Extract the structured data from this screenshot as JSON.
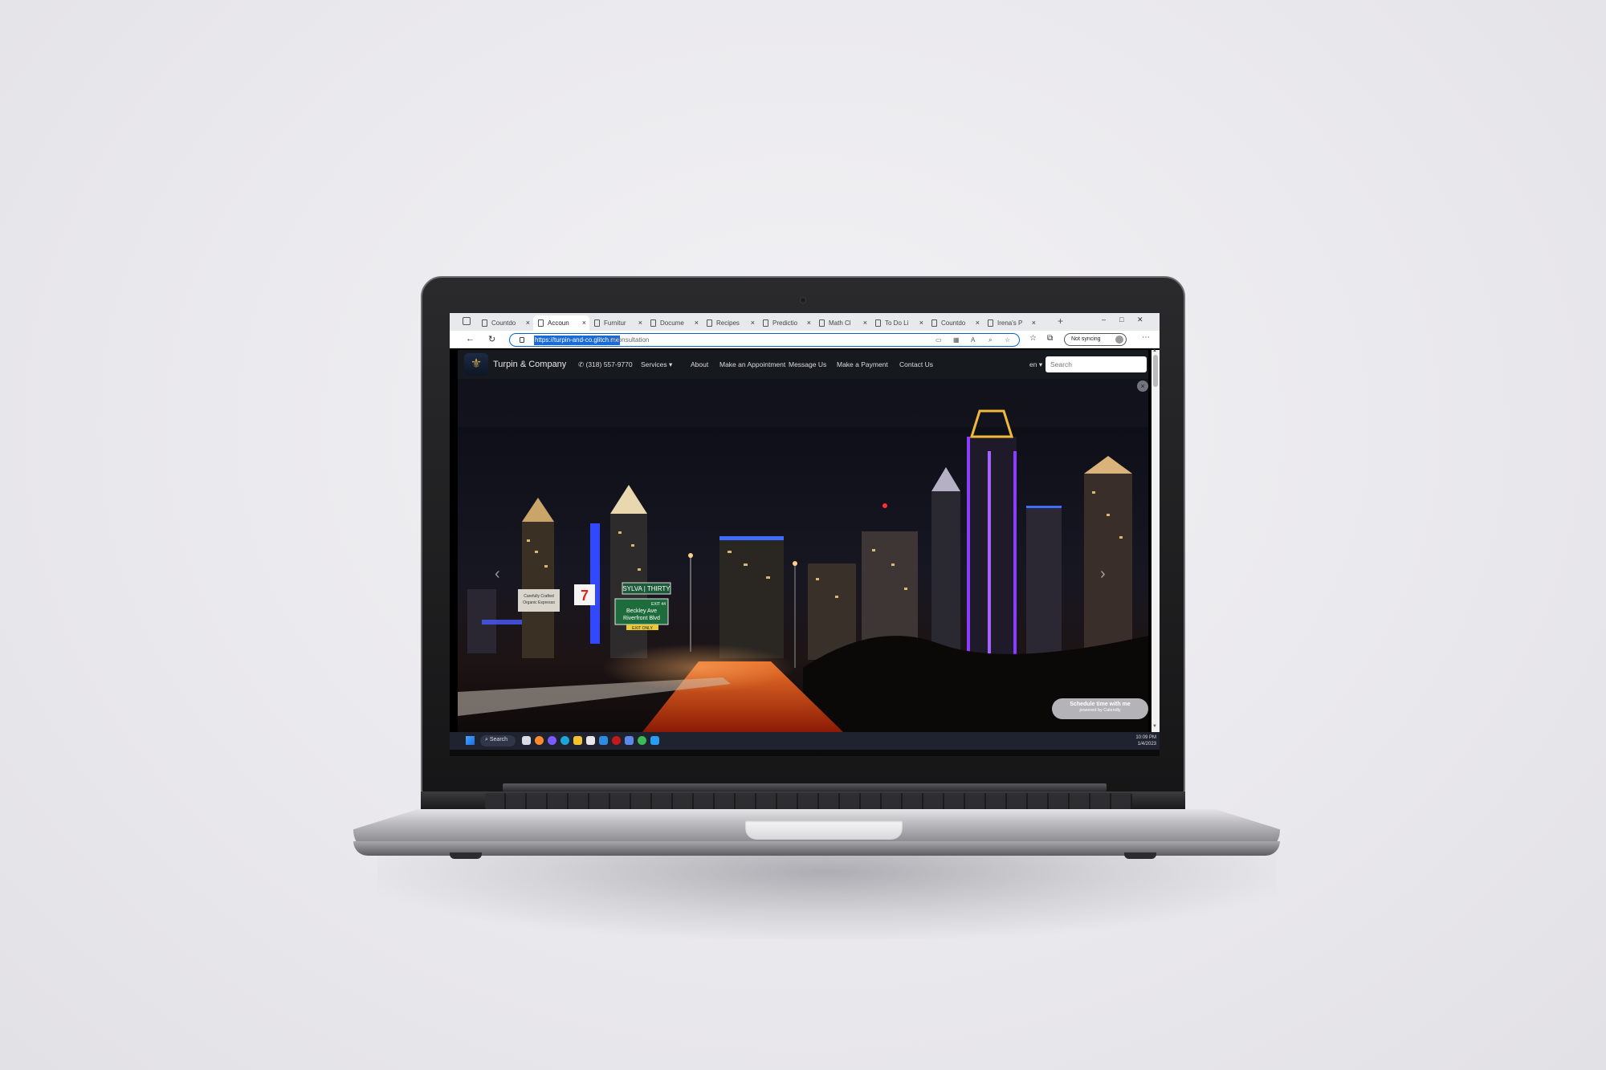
{
  "browser": {
    "tabs": [
      {
        "label": "Countdo",
        "active": false
      },
      {
        "label": "Accoun",
        "active": true
      },
      {
        "label": "Furnitur",
        "active": false
      },
      {
        "label": "Docume",
        "active": false
      },
      {
        "label": "Recipes",
        "active": false
      },
      {
        "label": "Predictio",
        "active": false
      },
      {
        "label": "Math Cl",
        "active": false
      },
      {
        "label": "To Do Li",
        "active": false
      },
      {
        "label": "Countdo",
        "active": false
      },
      {
        "label": "Irena's P",
        "active": false
      }
    ],
    "close_glyph": "×",
    "new_tab_glyph": "+",
    "url_highlighted": "https://turpin-and-co.glitch.me",
    "url_rest": "/?consultation",
    "sync_label": "Not syncing"
  },
  "site": {
    "brand": "Turpin & Company",
    "phone": "(318) 557-9770",
    "nav": [
      "Services ▾",
      "About",
      "Make an Appointment",
      "Message Us",
      "Make a Payment",
      "Contact Us"
    ],
    "language": "en ▾",
    "search_placeholder": "Search",
    "hero": {
      "signs": {
        "sylva": "SYLVA | THIRTY",
        "exit_number": "EXIT 44",
        "exit_line1": "Beckley Ave",
        "exit_line2": "Riverfront Blvd",
        "exit_only": "EXIT ONLY",
        "billboard_line1": "Carefully Crafted",
        "billboard_line2": "Organic Espresso"
      }
    },
    "calendly": {
      "label": "Schedule time with me",
      "sublabel": "powered by Calendly"
    }
  },
  "taskbar": {
    "search_label": "Search",
    "time": "10:09 PM",
    "date": "1/4/2023"
  },
  "colors": {
    "accent": "#1a6bd6",
    "nav_bg": "#16191d",
    "logo_gold": "#c9a44b",
    "building_purple": "#8a3cff",
    "building_gold": "#f0b93a"
  }
}
